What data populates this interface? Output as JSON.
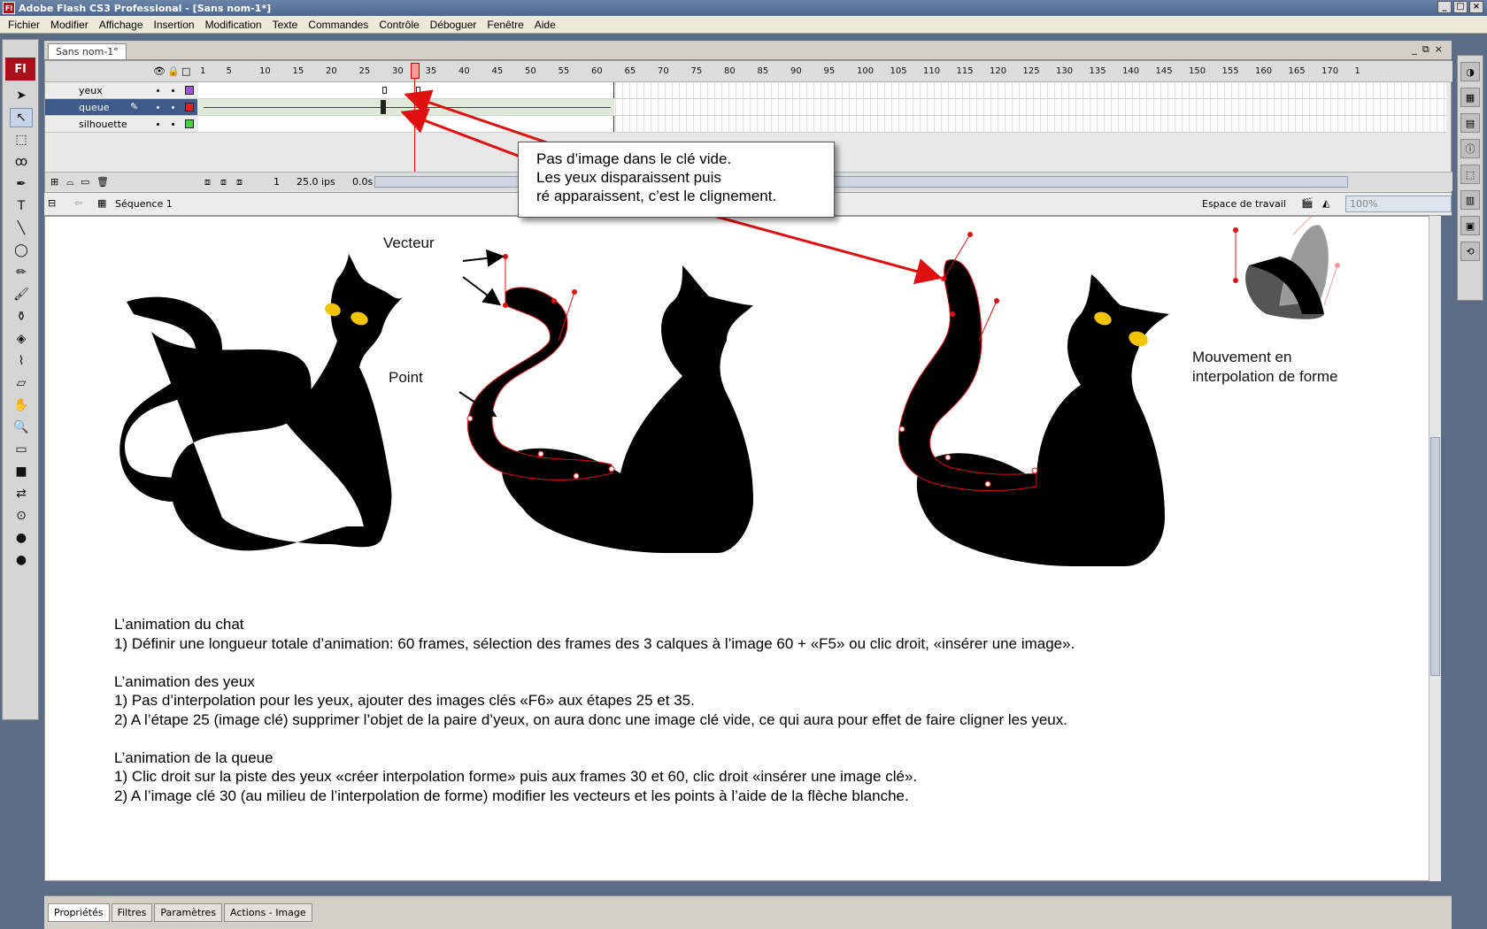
{
  "window": {
    "title": "Adobe Flash CS3 Professional - [Sans nom-1*]",
    "app_icon": "Fl"
  },
  "menu": [
    "Fichier",
    "Modifier",
    "Affichage",
    "Insertion",
    "Modification",
    "Texte",
    "Commandes",
    "Contrôle",
    "Déboguer",
    "Fenêtre",
    "Aide"
  ],
  "document_tab": "Sans nom-1°",
  "timeline": {
    "layers": [
      {
        "name": "yeux",
        "color": "#a050d0"
      },
      {
        "name": "queue",
        "color": "#e02020"
      },
      {
        "name": "silhouette",
        "color": "#40d040"
      }
    ],
    "ruler": [
      "1",
      "5",
      "10",
      "15",
      "20",
      "25",
      "30",
      "35",
      "40",
      "45",
      "50",
      "55",
      "60",
      "65",
      "70",
      "75",
      "80",
      "85",
      "90",
      "95",
      "100",
      "105",
      "110",
      "115",
      "120",
      "125",
      "130",
      "135",
      "140",
      "145",
      "150",
      "155",
      "160",
      "165",
      "170",
      "1"
    ],
    "current_frame": "1",
    "fps": "25.0 ips",
    "time": "0.0s"
  },
  "scene": {
    "name": "Séquence 1",
    "workspace": "Espace de travail",
    "zoom": "100%"
  },
  "stage": {
    "label_vecteur": "Vecteur",
    "label_point": "Point",
    "label_motion": [
      "Mouvement en",
      "interpolation de forme"
    ],
    "callout": [
      "Pas d’image dans le clé vide.",
      "Les yeux disparaissent puis",
      "ré apparaissent, c’est le clignement."
    ],
    "instructions": [
      "L’animation du chat",
      "1) Définir une longueur totale d’animation: 60 frames, sélection des frames des 3 calques à l’image 60 + «F5» ou clic droit, «insérer une image».",
      "",
      "L’animation des yeux",
      "1) Pas d’interpolation pour les yeux, ajouter des images clés «F6» aux étapes 25 et 35.",
      "2) A l’étape 25 (image clé) supprimer l’objet de la paire d’yeux, on aura donc une image clé vide, ce qui aura pour effet de faire cligner les yeux.",
      "",
      "L’animation de la queue",
      "1) Clic droit sur la piste des yeux «créer interpolation forme» puis aux frames 30 et 60, clic droit «insérer une image clé».",
      "2) A l’image clé 30 (au milieu de l’interpolation de forme) modifier les vecteurs et les points à l’aide de la flèche blanche."
    ]
  },
  "bottom_tabs": [
    "Propriétés",
    "Filtres",
    "Paramètres",
    "Actions - Image"
  ],
  "colors": {
    "accent_red": "#e01010",
    "eye_yellow": "#f5c400"
  }
}
